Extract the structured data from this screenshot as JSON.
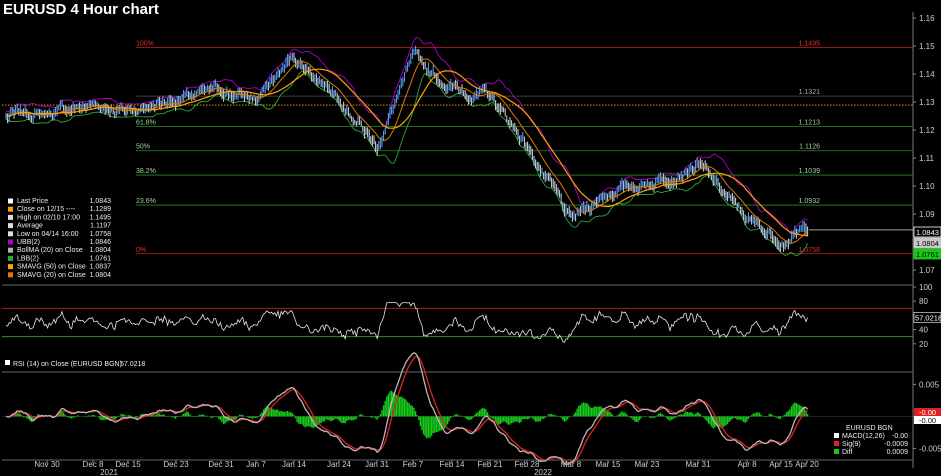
{
  "title": "EURUSD 4 Hour chart",
  "colors": {
    "background": "#000000",
    "price_up": "#5aa7ff",
    "price_down": "#c9d6e6",
    "ubb": "#b000c8",
    "lbb": "#2fa83a",
    "bollma": "#b0b0b0",
    "smavg50": "#ffa200",
    "smavg20": "#e07a00",
    "fib_line": "#2a8a2a",
    "fib_100": "#c81e1e",
    "rsi_line": "#e8e8e8",
    "rsi_upper": "#c81e1e",
    "rsi_lower": "#2fa83a",
    "macd": "#b8b8b8",
    "sig": "#e02020",
    "diff": "#17c91a"
  },
  "chart_data": [
    {
      "panel": "price",
      "type": "line",
      "ylim": [
        1.065,
        1.16
      ],
      "y_ticks": [
        "1.16",
        "1.15",
        "1.14",
        "1.13",
        "1.12",
        "1.11",
        "1.10",
        "1.09",
        "1.08",
        "1.07"
      ],
      "x_ticks": [
        "Nov 30",
        "Dec 8",
        "Dec 15",
        "Dec 23",
        "Dec 31",
        "Jan 7",
        "Jan 14",
        "Jan 24",
        "Jan 31",
        "Feb 7",
        "Feb 14",
        "Feb 21",
        "Feb 28",
        "Mar 8",
        "Mar 15",
        "Mar 23",
        "Mar 31",
        "Apr 8",
        "Apr 15",
        "Apr 20"
      ],
      "x_year_labels": [
        {
          "label": "2021",
          "at": "Dec 8"
        },
        {
          "label": "2022",
          "at": "Feb 28"
        }
      ],
      "price_anchors": [
        {
          "x": "Nov 24",
          "y": 1.125
        },
        {
          "x": "Nov 30",
          "y": 1.126
        },
        {
          "x": "Dec 8",
          "y": 1.129
        },
        {
          "x": "Dec 15",
          "y": 1.127
        },
        {
          "x": "Dec 23",
          "y": 1.131
        },
        {
          "x": "Dec 31",
          "y": 1.134
        },
        {
          "x": "Jan 7",
          "y": 1.131
        },
        {
          "x": "Jan 14",
          "y": 1.146
        },
        {
          "x": "Jan 24",
          "y": 1.133
        },
        {
          "x": "Jan 31",
          "y": 1.114
        },
        {
          "x": "Feb 7",
          "y": 1.145
        },
        {
          "x": "Feb 14",
          "y": 1.135
        },
        {
          "x": "Feb 21",
          "y": 1.132
        },
        {
          "x": "Feb 28",
          "y": 1.115
        },
        {
          "x": "Mar 8",
          "y": 1.087
        },
        {
          "x": "Mar 15",
          "y": 1.098
        },
        {
          "x": "Mar 23",
          "y": 1.101
        },
        {
          "x": "Mar 31",
          "y": 1.108
        },
        {
          "x": "Apr 8",
          "y": 1.088
        },
        {
          "x": "Apr 15",
          "y": 1.081
        },
        {
          "x": "Apr 20",
          "y": 1.0843
        }
      ],
      "fib_levels": [
        {
          "label_left": "100%",
          "value": 1.1495,
          "label_right": "1.1495",
          "color": "#c81e1e"
        },
        {
          "label_left": "",
          "value": 1.1321,
          "label_right": "1.1321",
          "color": "#555555"
        },
        {
          "label_left": "61.8%",
          "value": 1.1213,
          "label_right": "1.1213",
          "color": "#2a8a2a"
        },
        {
          "label_left": "50%",
          "value": 1.1126,
          "label_right": "1.1126",
          "color": "#2a8a2a"
        },
        {
          "label_left": "38.2%",
          "value": 1.1039,
          "label_right": "1.1039",
          "color": "#2a8a2a"
        },
        {
          "label_left": "23.6%",
          "value": 1.0932,
          "label_right": "1.0932",
          "color": "#2a8a2a"
        },
        {
          "label_left": "0%",
          "value": 1.0758,
          "label_right": "1.0758",
          "color": "#c81e1e"
        }
      ],
      "close_line": {
        "value": 1.1289,
        "color": "#ffa200"
      },
      "last_line": {
        "value": 1.0843,
        "color": "#ffffff"
      },
      "legend": [
        {
          "label": "Last Price",
          "value": "1.0843",
          "color": "#ffffff"
        },
        {
          "label": "Close on 12/15 ----",
          "value": "1.1289",
          "color": "#ffa200"
        },
        {
          "label": "High on 02/10 17:00",
          "value": "1.1495",
          "color": "#dddddd"
        },
        {
          "label": "Average",
          "value": "1.1197",
          "color": "#dddddd"
        },
        {
          "label": "Low on 04/14 16:00",
          "value": "1.0758",
          "color": "#dddddd"
        },
        {
          "label": "UBB(2)",
          "value": "1.0846",
          "color": "#b000c8"
        },
        {
          "label": "BollMA (20)  on Close",
          "value": "1.0804",
          "color": "#b0b0b0"
        },
        {
          "label": "LBB(2)",
          "value": "1.0761",
          "color": "#2fa83a"
        },
        {
          "label": "SMAVG (50)  on Close",
          "value": "1.0837",
          "color": "#ffa200"
        },
        {
          "label": "SMAVG (20)  on Close",
          "value": "1.0804",
          "color": "#e07a00"
        }
      ],
      "right_tags": [
        {
          "text": "1.0843",
          "bg": "#000000",
          "fg": "#ffffff",
          "border": "#ffffff",
          "value": 1.0843
        },
        {
          "text": "1.0804",
          "bg": "#c8c8c8",
          "fg": "#000000",
          "border": "#c8c8c8",
          "value": 1.0804
        },
        {
          "text": "1.0761",
          "bg": "#17c91a",
          "fg": "#000000",
          "border": "#17c91a",
          "value": 1.0761
        }
      ]
    },
    {
      "panel": "rsi",
      "type": "line",
      "ylim": [
        0,
        100
      ],
      "y_ticks": [
        "100",
        "80",
        "60",
        "40",
        "20"
      ],
      "upper_band": 70,
      "lower_band": 30,
      "legend_label": "RSI (14)  on Close (EURUSD BGN)",
      "legend_value": "57.0218",
      "tag": {
        "text": "57.0218",
        "value": 57.0218
      }
    },
    {
      "panel": "macd",
      "type": "line",
      "ylim": [
        -0.0065,
        0.006
      ],
      "y_ticks": [
        "0.005",
        "0.000",
        "-0.005"
      ],
      "legend_title": "EURUSD BGN",
      "legend": [
        {
          "label": "MACD(12,26)",
          "value": "-0.00",
          "color": "#ffffff"
        },
        {
          "label": "Sig(9)",
          "value": "-0.0009",
          "color": "#e02020"
        },
        {
          "label": "Diff",
          "value": "0.0009",
          "color": "#17c91a"
        }
      ],
      "tags": [
        {
          "text": "-0.00",
          "bg": "#e02020",
          "fg": "#ffffff"
        },
        {
          "text": "-0.00",
          "bg": "#ffffff",
          "fg": "#000000"
        }
      ]
    }
  ]
}
